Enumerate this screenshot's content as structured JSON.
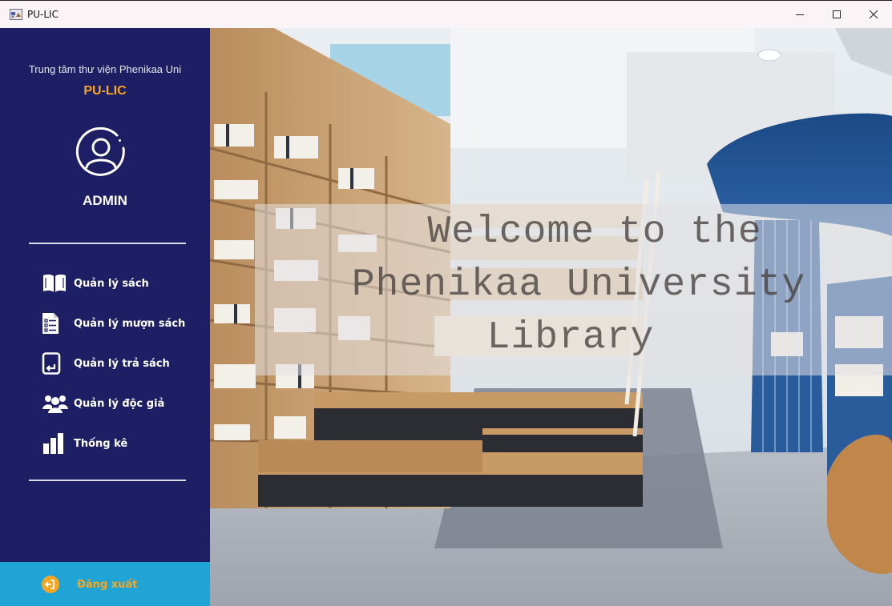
{
  "window": {
    "title": "PU-LIC",
    "controls": [
      "minimize",
      "maximize",
      "close"
    ]
  },
  "sidebar": {
    "org_name": "Trung tâm thư viện Phenikaa Uni",
    "brand": "PU-LIC",
    "role": "ADMIN",
    "menu": [
      {
        "label": "Quản lý sách",
        "icon": "book-icon"
      },
      {
        "label": "Quản lý mượn sách",
        "icon": "document-list-icon"
      },
      {
        "label": "Quản lý trả sách",
        "icon": "return-book-icon"
      },
      {
        "label": "Quản lý độc giả",
        "icon": "users-icon"
      },
      {
        "label": "Thống kê",
        "icon": "bar-chart-icon"
      }
    ],
    "logout": {
      "label": "Đăng xuất",
      "icon": "logout-icon"
    }
  },
  "main": {
    "welcome_lines": [
      "Welcome to the",
      "Phenikaa University",
      "Library"
    ]
  },
  "colors": {
    "sidebar_bg": "#1d1e63",
    "brand_accent": "#f5a623",
    "logout_bg": "#20a4d6",
    "titlebar_bg": "#fbf4f6"
  }
}
